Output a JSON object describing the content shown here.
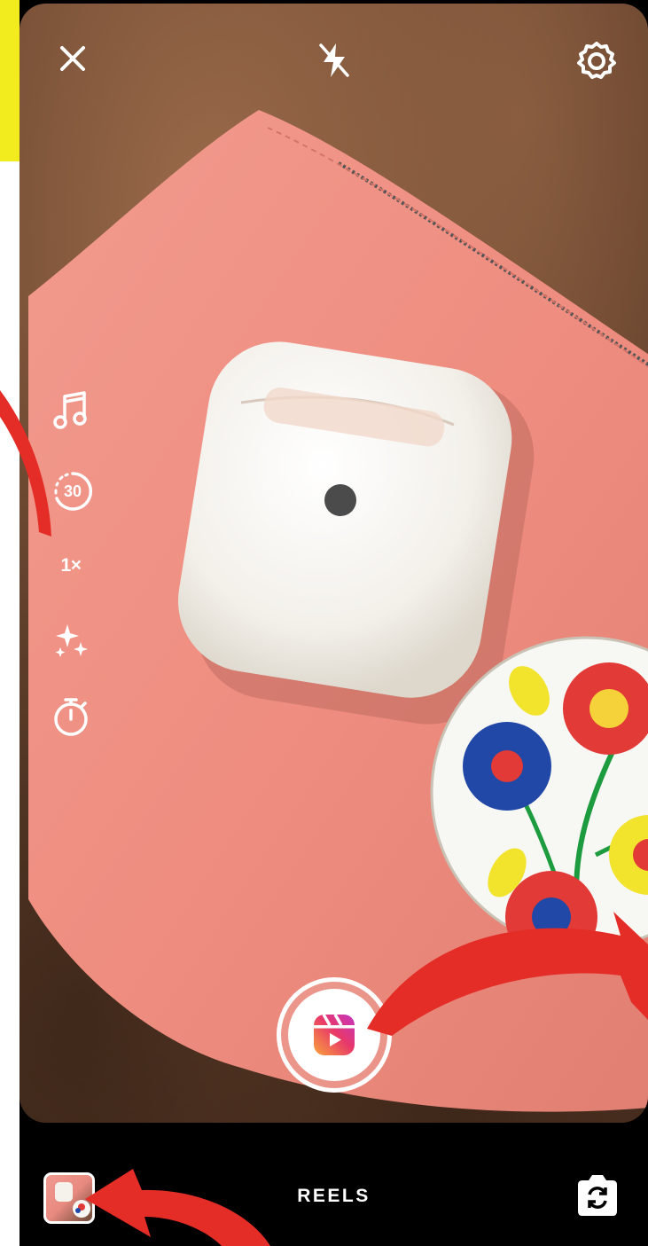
{
  "camera": {
    "mode_label": "REELS",
    "timer_duration": "30",
    "speed": "1×"
  },
  "icons": {
    "close": "close-icon",
    "flash": "flash-off-icon",
    "settings": "settings-gear-icon",
    "music": "music-note-icon",
    "length": "length-30-icon",
    "effects": "sparkles-icon",
    "timer": "stopwatch-icon",
    "shutter": "reels-shutter-icon",
    "flip": "flip-camera-icon"
  },
  "colors": {
    "annotation_arrow": "#e52d27",
    "highlight": "#f2ec1f",
    "reels_gradient_start": "#f9a23a",
    "reels_gradient_end": "#c436c2"
  }
}
